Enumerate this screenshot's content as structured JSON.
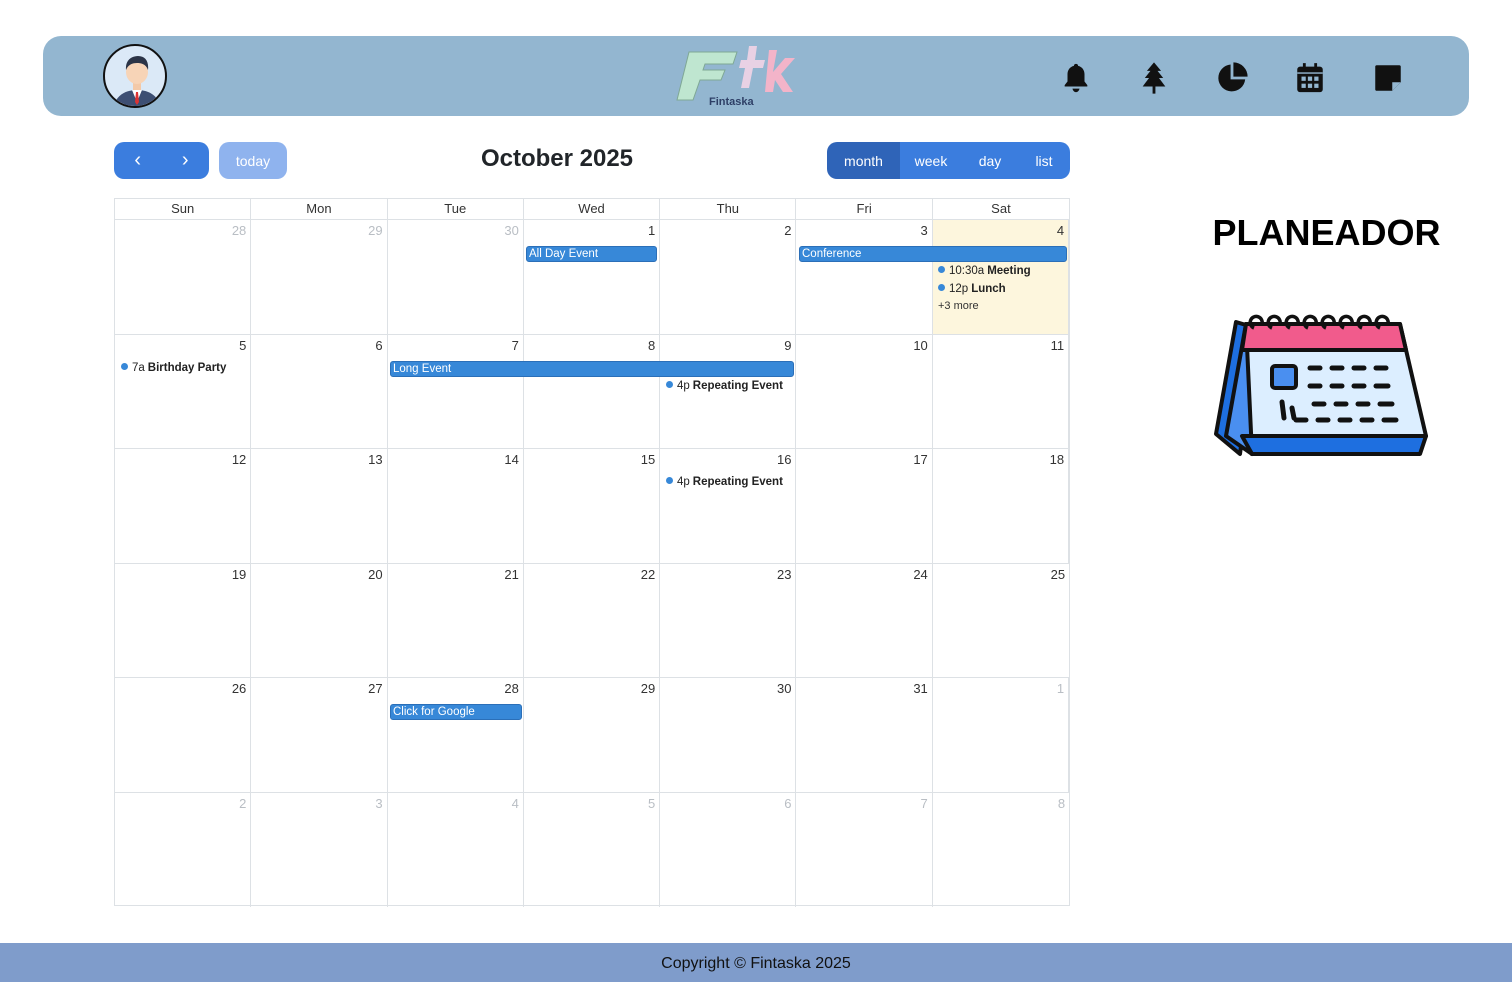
{
  "header": {
    "avatar_icon": "user-avatar-icon",
    "logo_text": "Fintaska",
    "nav": [
      {
        "name": "bell-icon"
      },
      {
        "name": "tree-icon"
      },
      {
        "name": "pie-chart-icon"
      },
      {
        "name": "calendar-icon"
      },
      {
        "name": "note-icon"
      }
    ]
  },
  "calendar": {
    "prev_label": "‹",
    "next_label": "›",
    "today_label": "today",
    "title": "October 2025",
    "views": {
      "month": "month",
      "week": "week",
      "day": "day",
      "list": "list"
    },
    "active_view": "month",
    "weekdays": [
      "Sun",
      "Mon",
      "Tue",
      "Wed",
      "Thu",
      "Fri",
      "Sat"
    ],
    "weeks": [
      [
        "28",
        "29",
        "30",
        "1",
        "2",
        "3",
        "4"
      ],
      [
        "5",
        "6",
        "7",
        "8",
        "9",
        "10",
        "11"
      ],
      [
        "12",
        "13",
        "14",
        "15",
        "16",
        "17",
        "18"
      ],
      [
        "19",
        "20",
        "21",
        "22",
        "23",
        "24",
        "25"
      ],
      [
        "26",
        "27",
        "28",
        "29",
        "30",
        "31",
        "1"
      ],
      [
        "2",
        "3",
        "4",
        "5",
        "6",
        "7",
        "8"
      ]
    ],
    "events": {
      "all_day": "All Day Event",
      "conference": "Conference",
      "meeting_time": "10:30a",
      "meeting": "Meeting",
      "lunch_time": "12p",
      "lunch": "Lunch",
      "more": "+3 more",
      "birthday_time": "7a",
      "birthday": "Birthday Party",
      "long_event": "Long Event",
      "repeat1_time": "4p",
      "repeat1": "Repeating Event",
      "repeat2_time": "4p",
      "repeat2": "Repeating Event",
      "google": "Click for Google"
    },
    "colors": {
      "event": "#3788d8",
      "today_bg": "#fdf6dd",
      "button": "#3b7dde"
    }
  },
  "planner": {
    "title": "PLANEADOR"
  },
  "footer": {
    "copyright": "Copyright © Fintaska 2025"
  }
}
